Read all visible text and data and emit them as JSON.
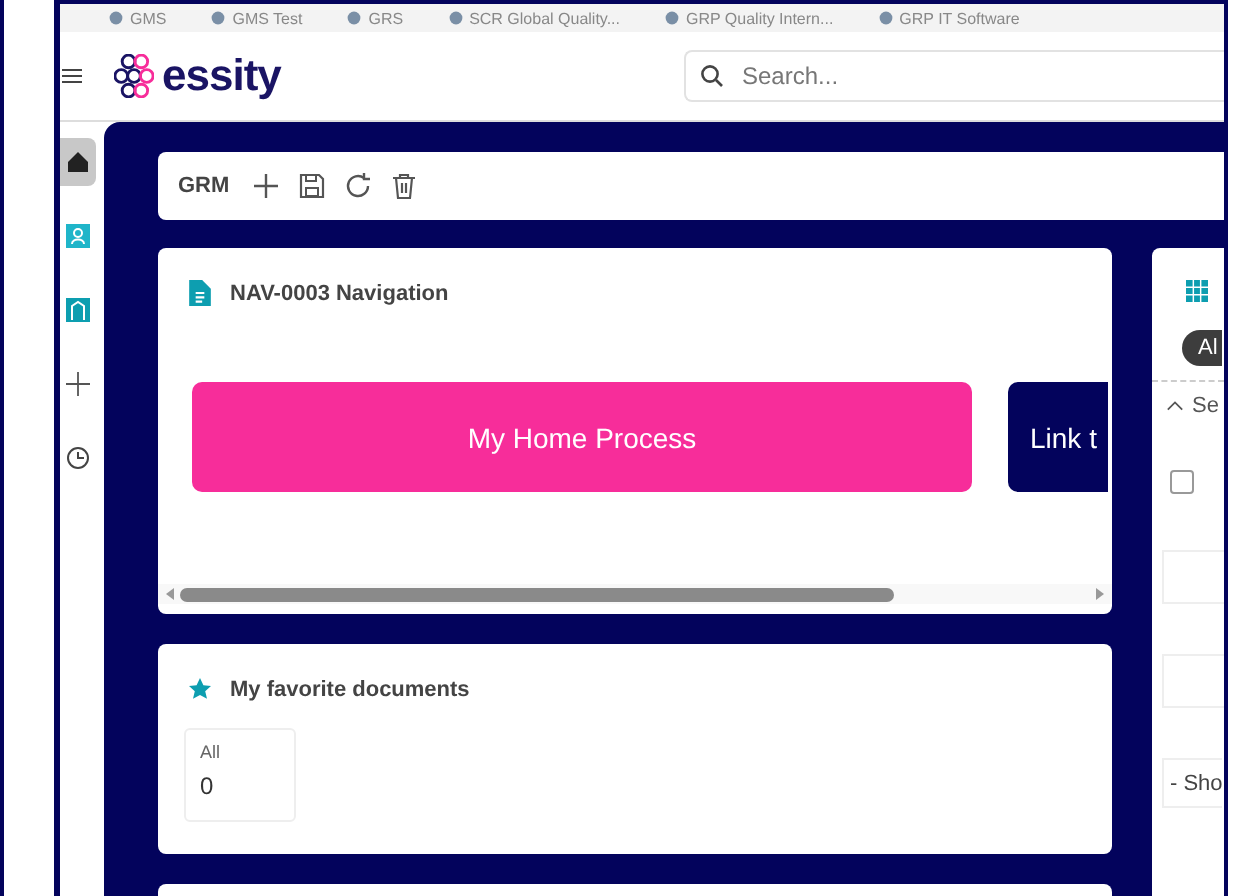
{
  "bookmarks": [
    {
      "label": "GMS"
    },
    {
      "label": "GMS Test"
    },
    {
      "label": "GRS"
    },
    {
      "label": "SCR Global Quality..."
    },
    {
      "label": "GRP Quality Intern..."
    },
    {
      "label": "GRP IT Software"
    }
  ],
  "header": {
    "logo_text": "essity",
    "search": {
      "placeholder": "Search..."
    }
  },
  "sidebar": {
    "items": [
      {
        "kind": "home",
        "selected": true
      },
      {
        "kind": "person",
        "selected": false
      },
      {
        "kind": "building",
        "selected": false
      },
      {
        "kind": "add",
        "selected": false
      },
      {
        "kind": "history",
        "selected": false
      }
    ]
  },
  "toolbar": {
    "label": "GRM",
    "actions": [
      {
        "kind": "add"
      },
      {
        "kind": "save"
      },
      {
        "kind": "refresh"
      },
      {
        "kind": "delete"
      }
    ]
  },
  "navigation_card": {
    "title": "NAV-0003 Navigation",
    "links": [
      {
        "label": "My Home Process",
        "color": "#f72d9a"
      },
      {
        "label": "Link t",
        "color": "#03035c"
      }
    ]
  },
  "favorites_card": {
    "title": "My favorite documents",
    "counters": [
      {
        "label": "All",
        "value": "0"
      }
    ]
  },
  "right_panel": {
    "chip": "Al",
    "section": "Se",
    "checkbox": {
      "checked": false
    },
    "dropdown": "- Sho"
  }
}
